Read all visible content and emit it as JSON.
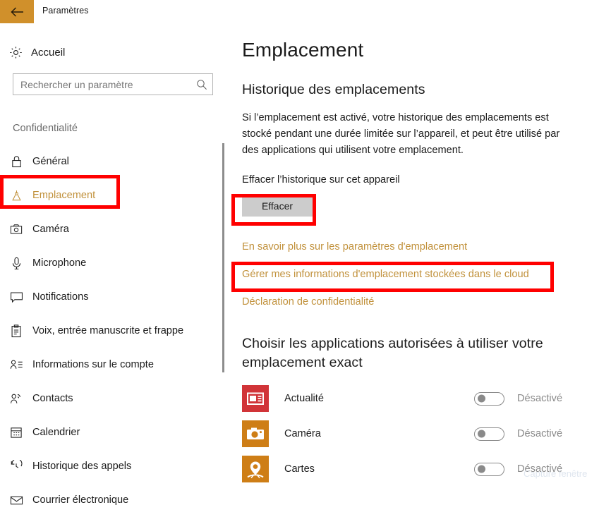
{
  "titlebar": {
    "back_icon": "back-arrow-icon",
    "title": "Paramètres",
    "accent_color": "#D0902B"
  },
  "sidebar": {
    "home": {
      "label": "Accueil",
      "icon": "gear-icon"
    },
    "search": {
      "placeholder": "Rechercher un paramètre",
      "value": "",
      "icon": "search-icon"
    },
    "section_header": "Confidentialité",
    "items": [
      {
        "label": "Général",
        "icon": "lock-icon",
        "selected": false
      },
      {
        "label": "Emplacement",
        "icon": "location-pin-icon",
        "selected": true
      },
      {
        "label": "Caméra",
        "icon": "camera-icon",
        "selected": false
      },
      {
        "label": "Microphone",
        "icon": "microphone-icon",
        "selected": false
      },
      {
        "label": "Notifications",
        "icon": "speech-bubble-icon",
        "selected": false
      },
      {
        "label": "Voix, entrée manuscrite et frappe",
        "icon": "clipboard-icon",
        "selected": false
      },
      {
        "label": "Informations sur le compte",
        "icon": "person-list-icon",
        "selected": false
      },
      {
        "label": "Contacts",
        "icon": "contacts-icon",
        "selected": false
      },
      {
        "label": "Calendrier",
        "icon": "calendar-icon",
        "selected": false
      },
      {
        "label": "Historique des appels",
        "icon": "call-history-icon",
        "selected": false
      },
      {
        "label": "Courrier électronique",
        "icon": "envelope-icon",
        "selected": false
      }
    ],
    "selected_color": "#C1913B"
  },
  "main": {
    "page_title": "Emplacement",
    "history_heading": "Historique des emplacements",
    "history_description": "Si l’emplacement est activé, votre historique des emplacements est stocké pendant une durée limitée sur l’appareil, et peut être utilisé par des applications qui utilisent votre emplacement.",
    "clear_label": "Effacer l’historique sur cet appareil",
    "clear_button": "Effacer",
    "links": [
      {
        "label": "En savoir plus sur les paramètres d'emplacement"
      },
      {
        "label": "Gérer mes informations d'emplacement stockées dans le cloud"
      },
      {
        "label": "Déclaration de confidentialité"
      }
    ],
    "link_color": "#C1913B",
    "apps_heading": "Choisir les applications autorisées à utiliser votre emplacement exact",
    "apps": [
      {
        "name": "Actualité",
        "icon": "news-app-icon",
        "icon_color": "#D13438",
        "toggle_state": "Désactivé",
        "toggle_on": false
      },
      {
        "name": "Caméra",
        "icon": "camera-app-icon",
        "icon_color": "#CE7E16",
        "toggle_state": "Désactivé",
        "toggle_on": false
      },
      {
        "name": "Cartes",
        "icon": "maps-app-icon",
        "icon_color": "#CE7E16",
        "toggle_state": "Désactivé",
        "toggle_on": false
      }
    ]
  },
  "annotations": {
    "color": "#FF0000",
    "boxes": [
      {
        "name": "sidebar-item-emplacement-highlight"
      },
      {
        "name": "effacer-button-highlight"
      },
      {
        "name": "cloud-link-highlight"
      }
    ]
  },
  "watermark": {
    "text": "Capture fenêtre"
  }
}
